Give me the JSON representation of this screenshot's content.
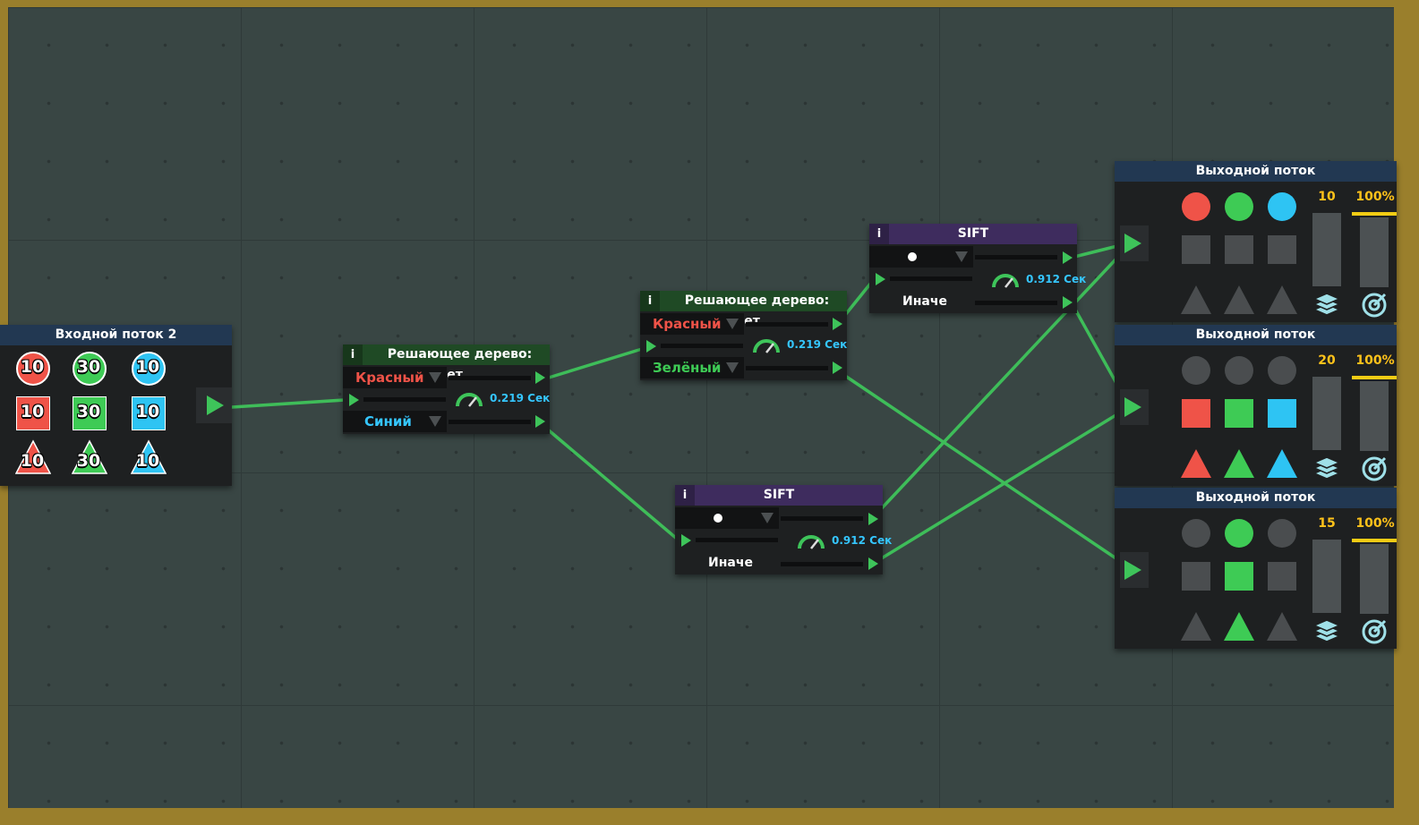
{
  "colors": {
    "red": "#ef5348",
    "green": "#3ecb55",
    "blue": "#2ec4f3",
    "gray": "#4a4d4f",
    "wire": "#3fc45b",
    "speed": "#35c6ff",
    "yellow": "#ffc21a"
  },
  "input_node": {
    "title": "Входной поток 2",
    "items": [
      {
        "shape": "circle",
        "color": "red",
        "count": "10"
      },
      {
        "shape": "circle",
        "color": "green",
        "count": "30"
      },
      {
        "shape": "circle",
        "color": "blue",
        "count": "10"
      },
      {
        "shape": "square",
        "color": "red",
        "count": "10"
      },
      {
        "shape": "square",
        "color": "green",
        "count": "30"
      },
      {
        "shape": "square",
        "color": "blue",
        "count": "10"
      },
      {
        "shape": "triangle",
        "color": "red",
        "count": "10"
      },
      {
        "shape": "triangle",
        "color": "green",
        "count": "30"
      },
      {
        "shape": "triangle",
        "color": "blue",
        "count": "10"
      }
    ],
    "play_icon": "play-triangle-icon"
  },
  "tree_node_1": {
    "info": "i",
    "title": "Решающее дерево: цвет",
    "option1": "Красный",
    "option2": "Синий",
    "speed": "0.219 Сек"
  },
  "tree_node_2": {
    "info": "i",
    "title": "Решающее дерево: цвет",
    "option1": "Красный",
    "option2": "Зелёный",
    "speed": "0.219 Сек"
  },
  "sift_node_1": {
    "info": "i",
    "title": "SIFT",
    "filter_icon": "circle-dot-icon",
    "speed": "0.912 Сек",
    "else_label": "Иначе"
  },
  "sift_node_2": {
    "info": "i",
    "title": "SIFT",
    "filter_icon": "circle-dot-icon",
    "speed": "0.912 Сек",
    "else_label": "Иначе"
  },
  "outputs": [
    {
      "title": "Выходной поток",
      "count": "10",
      "percent": "100%",
      "circles": [
        "red",
        "green",
        "blue"
      ],
      "squares": [
        "gray",
        "gray",
        "gray"
      ],
      "triangles": [
        "gray",
        "gray",
        "gray"
      ],
      "progress": 1.0
    },
    {
      "title": "Выходной поток",
      "count": "20",
      "percent": "100%",
      "circles": [
        "gray",
        "gray",
        "gray"
      ],
      "squares": [
        "red",
        "green",
        "blue"
      ],
      "triangles": [
        "red",
        "green",
        "blue"
      ],
      "progress": 1.0
    },
    {
      "title": "Выходной поток",
      "count": "15",
      "percent": "100%",
      "circles": [
        "gray",
        "green",
        "gray"
      ],
      "squares": [
        "gray",
        "green",
        "gray"
      ],
      "triangles": [
        "gray",
        "green",
        "gray"
      ],
      "progress": 1.0
    }
  ]
}
